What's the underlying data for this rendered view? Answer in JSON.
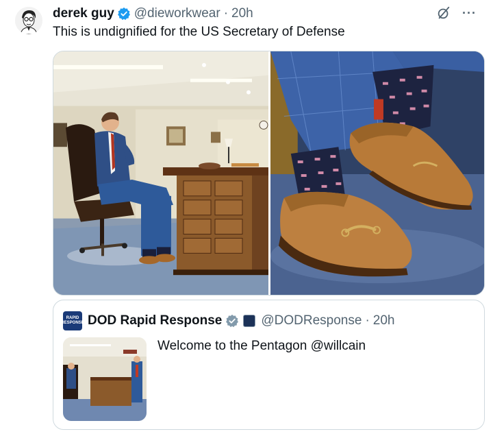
{
  "tweet": {
    "author_name": "derek guy",
    "author_handle": "@dieworkwear",
    "separator": "·",
    "time": "20h",
    "text": "This is undignified for the US Secretary of Defense",
    "media": [
      {
        "alt": "Man in blue suit seated in leather chair beside wooden desk in office"
      },
      {
        "alt": "Close-up of brown loafers and patterned socks"
      }
    ]
  },
  "quote": {
    "author_name": "DOD Rapid Response",
    "author_handle": "@DODResponse",
    "separator": "·",
    "time": "20h",
    "text": "Welcome to the Pentagon @willcain",
    "avatar_text_1": "RAPID",
    "avatar_text_2": "RESPONSE"
  },
  "icons": {
    "verified": "verified-icon",
    "grok": "grok-icon",
    "more": "more-icon"
  },
  "colors": {
    "verified_blue": "#1d9bf0",
    "verified_gray": "#829aab",
    "secondary_text": "#536471",
    "border": "#cfd9de"
  }
}
